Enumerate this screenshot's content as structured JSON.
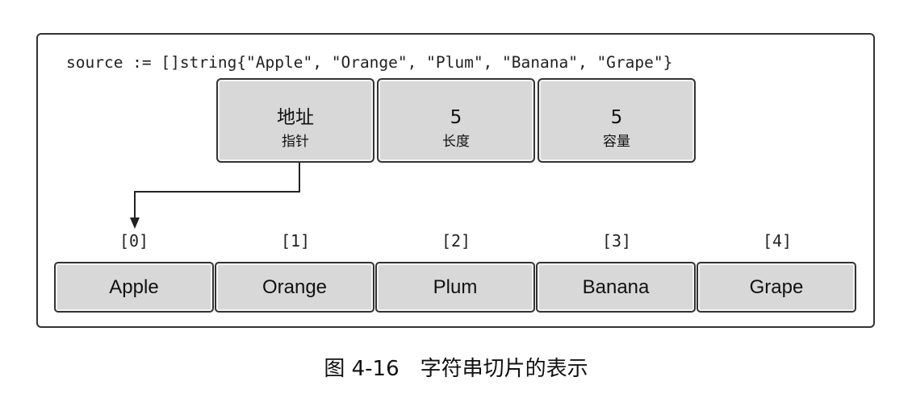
{
  "code": "source := []string{\"Apple\", \"Orange\", \"Plum\", \"Banana\", \"Grape\"}",
  "header": [
    {
      "value": "地址",
      "label": "指针"
    },
    {
      "value": "5",
      "label": "长度"
    },
    {
      "value": "5",
      "label": "容量"
    }
  ],
  "indices": [
    "[0]",
    "[1]",
    "[2]",
    "[3]",
    "[4]"
  ],
  "elements": [
    "Apple",
    "Orange",
    "Plum",
    "Banana",
    "Grape"
  ],
  "caption": "图 4-16　字符串切片的表示"
}
